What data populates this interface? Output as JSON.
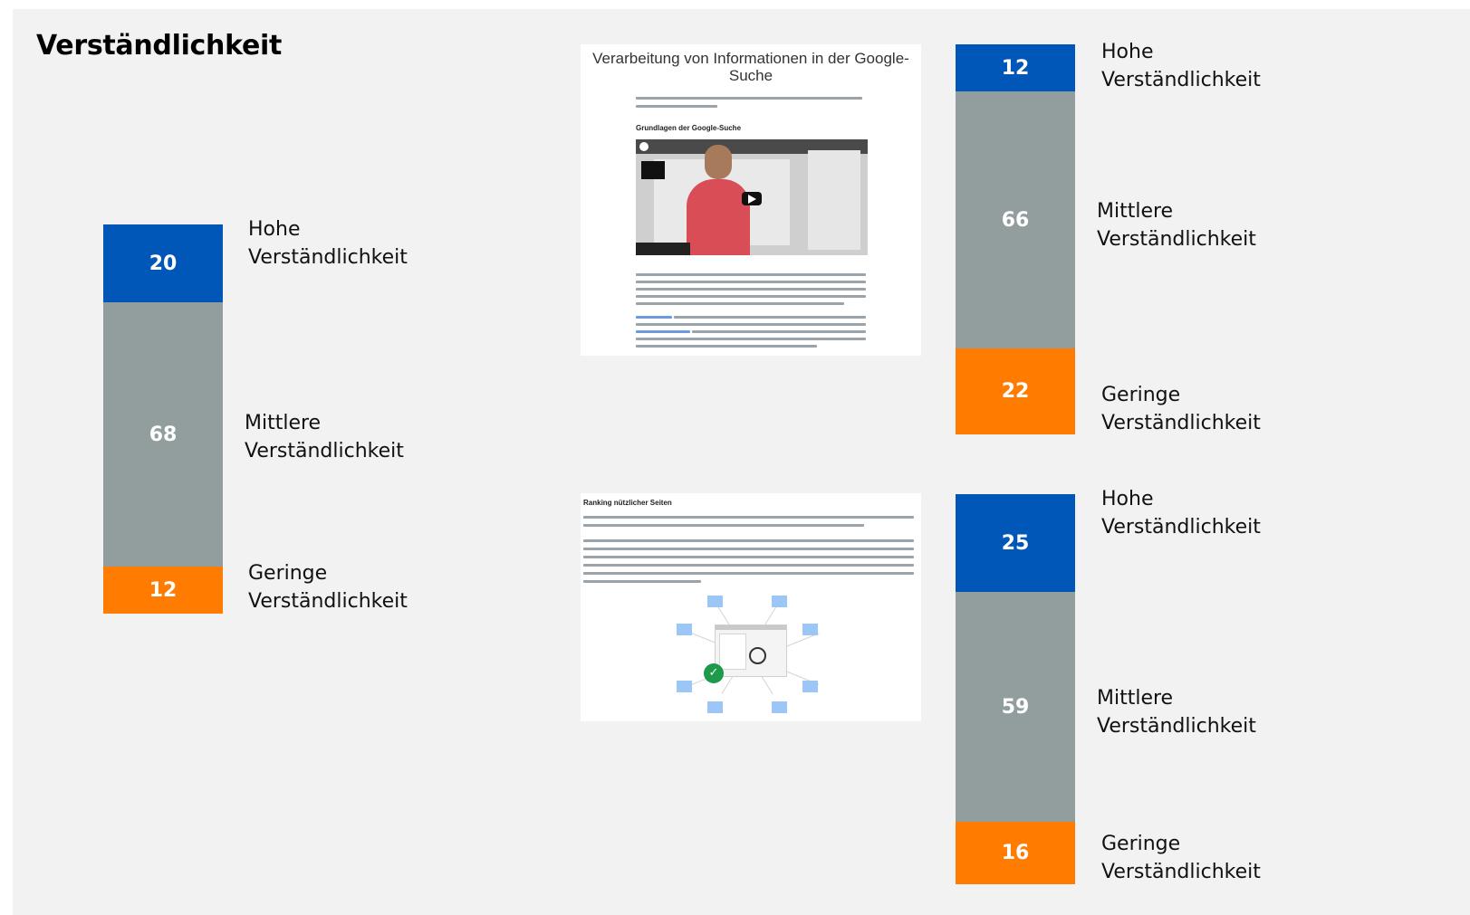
{
  "slide": {
    "title": "Verständlichkeit"
  },
  "screenshot_top": {
    "title_line1": "Verarbeitung von Informationen in der Google-",
    "title_line2": "Suche",
    "section_heading": "Grundlagen der Google-Suche"
  },
  "screenshot_bottom": {
    "section_heading": "Ranking nützlicher Seiten"
  },
  "colors": {
    "hohe": "#0057b8",
    "mittlere": "#929e9e",
    "geringe": "#ff7c00",
    "background": "#f2f2f2"
  },
  "chart_data": [
    {
      "type": "bar",
      "stacked": true,
      "categories": [
        "Hohe Verständlichkeit",
        "Mittlere Verständlichkeit",
        "Geringe Verständlichkeit"
      ],
      "values": [
        20,
        68,
        12
      ],
      "labels": [
        {
          "line1": "Hohe",
          "line2": "Verständlichkeit"
        },
        {
          "line1": "Mittlere",
          "line2": "Verständlichkeit"
        },
        {
          "line1": "Geringe",
          "line2": "Verständlichkeit"
        }
      ]
    },
    {
      "type": "bar",
      "stacked": true,
      "categories": [
        "Hohe Verständlichkeit",
        "Mittlere Verständlichkeit",
        "Geringe Verständlichkeit"
      ],
      "values": [
        12,
        66,
        22
      ],
      "labels": [
        {
          "line1": "Hohe",
          "line2": "Verständlichkeit"
        },
        {
          "line1": "Mittlere",
          "line2": "Verständlichkeit"
        },
        {
          "line1": "Geringe",
          "line2": "Verständlichkeit"
        }
      ]
    },
    {
      "type": "bar",
      "stacked": true,
      "categories": [
        "Hohe Verständlichkeit",
        "Mittlere Verständlichkeit",
        "Geringe Verständlichkeit"
      ],
      "values": [
        25,
        59,
        16
      ],
      "labels": [
        {
          "line1": "Hohe",
          "line2": "Verständlichkeit"
        },
        {
          "line1": "Mittlere",
          "line2": "Verständlichkeit"
        },
        {
          "line1": "Geringe",
          "line2": "Verständlichkeit"
        }
      ]
    }
  ]
}
